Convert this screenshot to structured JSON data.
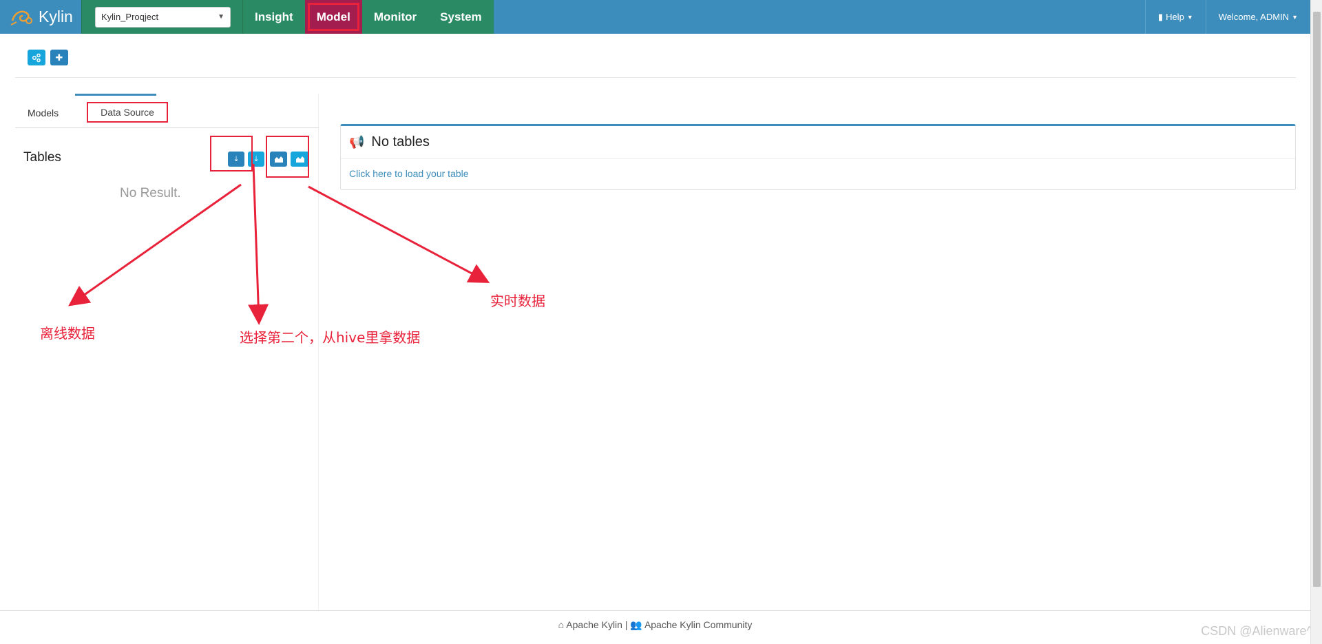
{
  "brand": {
    "name": "Kylin",
    "logo_icon": "kylin-logo-icon"
  },
  "project_select": {
    "value": "Kylin_Proqject"
  },
  "main_tabs": [
    {
      "label": "Insight",
      "active": false
    },
    {
      "label": "Model",
      "active": true
    },
    {
      "label": "Monitor",
      "active": false
    },
    {
      "label": "System",
      "active": false
    }
  ],
  "nav_right": {
    "help": "Help",
    "welcome": "Welcome, ADMIN"
  },
  "actions": {
    "icon1": "share-nodes-icon",
    "icon2": "plus-icon"
  },
  "sub_tabs": {
    "models": "Models",
    "data_source": "Data Source"
  },
  "tables": {
    "title": "Tables",
    "empty": "No Result.",
    "buttons": [
      "download-icon",
      "download-icon",
      "area-chart-icon",
      "area-chart-icon"
    ]
  },
  "right_panel": {
    "title": "No tables",
    "link": "Click here to load your table",
    "icon": "bullhorn-icon"
  },
  "annotations": {
    "offline": "离线数据",
    "hive": "选择第二个，从hive里拿数据",
    "realtime": "实时数据"
  },
  "footer": {
    "left": "Apache Kylin",
    "sep": "|",
    "right": "Apache Kylin Community"
  },
  "watermark": "CSDN @Alienware^",
  "colors": {
    "topbar": "#3c8dbc",
    "nav_green": "#2a8a64",
    "active_tab": "#a31e4f",
    "annotation_red": "#e8223a"
  }
}
